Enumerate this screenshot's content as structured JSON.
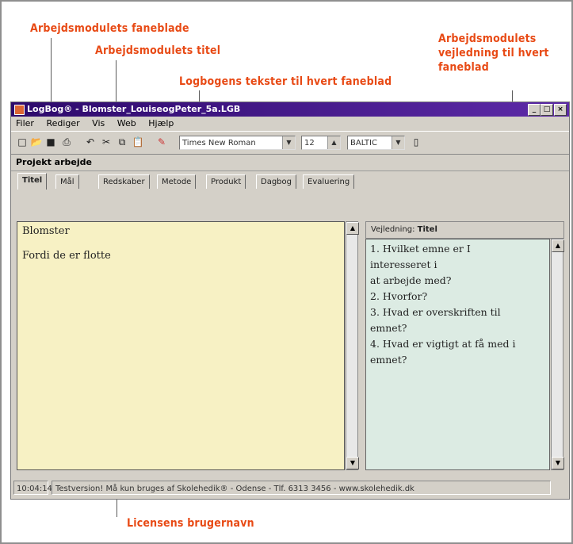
{
  "annotations": {
    "tabs_label": "Arbejdsmodulets faneblade",
    "title_label": "Arbejdsmodulets titel",
    "logbook_label": "Logbogens tekster til hvert faneblad",
    "guidance_label": "Arbejdsmodulets vejledning til hvert faneblad",
    "license_label": "Licensens brugernavn"
  },
  "window": {
    "title": "LogBog® - Blomster_LouiseogPeter_5a.LGB",
    "min": "_",
    "max": "□",
    "close": "×"
  },
  "menu": [
    "Filer",
    "Rediger",
    "Vis",
    "Web",
    "Hjælp"
  ],
  "toolbar": {
    "icons": [
      "new-icon",
      "open-icon",
      "save-icon",
      "print-icon",
      "undo-icon",
      "cut-icon",
      "copy-icon",
      "paste-icon",
      "format-icon"
    ],
    "font": "Times New Roman",
    "size": "12",
    "charset": "BALTIC",
    "extra": "▯"
  },
  "project": {
    "title": "Projekt arbejde"
  },
  "tabs": [
    "Titel",
    "Mål",
    "Redskaber",
    "Metode",
    "Produkt",
    "Dagbog",
    "Evaluering"
  ],
  "editor": {
    "text_line1": "Blomster",
    "text_line2": "Fordi de er flotte"
  },
  "guidance": {
    "header_prefix": "Vejledning:",
    "header_title": "Titel",
    "text": "1. Hvilket emne er I\ninteresseret i\nat arbejde med?\n2. Hvorfor?\n3. Hvad er overskriften til\nemnet?\n4. Hvad er vigtigt at få med i\nemnet?"
  },
  "status": {
    "left": "10:04:14",
    "main": "Testversion! Må kun bruges af Skolehedik® - Odense - Tlf. 6313 3456 - www.skolehedik.dk"
  },
  "colors": {
    "annotation": "#e84a15",
    "titlebar": "#3d1580",
    "editor_bg": "#f7f1c4",
    "guide_bg": "#dcebe3"
  }
}
